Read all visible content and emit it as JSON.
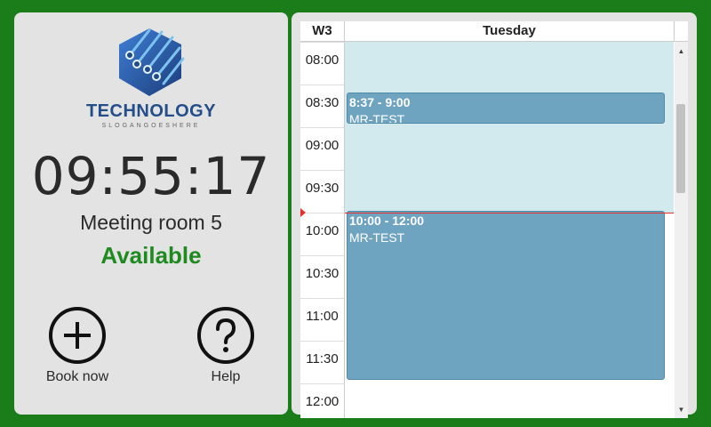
{
  "brand": {
    "name": "TECHNOLOGY",
    "slogan": "SLOGANGOESHERE",
    "colors": {
      "primary": "#234e8a",
      "accent": "#4fa3e0"
    }
  },
  "clock": {
    "time": "09:55:17"
  },
  "room": {
    "name": "Meeting room 5"
  },
  "status": {
    "label": "Available",
    "color": "#1f8a1f"
  },
  "actions": {
    "book": {
      "label": "Book now",
      "icon": "plus-circle-icon"
    },
    "help": {
      "label": "Help",
      "icon": "question-circle-icon"
    }
  },
  "calendar": {
    "week": "W3",
    "day": "Tuesday",
    "times": [
      "08:00",
      "08:30",
      "09:00",
      "09:30",
      "10:00",
      "10:30",
      "11:00",
      "11:30",
      "12:00"
    ],
    "current_time": "09:55",
    "events": [
      {
        "time": "8:37 - 9:00",
        "title": "MR-TEST",
        "start": "08:37",
        "end": "09:00"
      },
      {
        "time": "10:00 - 12:00",
        "title": "MR-TEST",
        "start": "10:00",
        "end": "12:00"
      }
    ],
    "colors": {
      "event": "#6fa4c0",
      "past": "#d2e9ee",
      "now_line": "#e53030"
    }
  }
}
